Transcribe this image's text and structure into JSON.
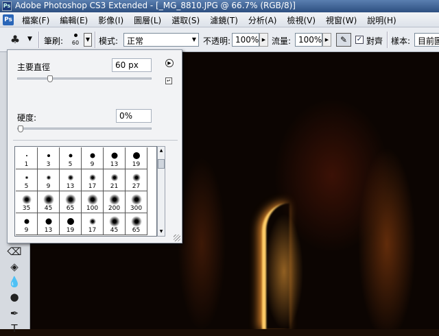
{
  "window": {
    "title": "Adobe Photoshop CS3 Extended - [_MG_8810.JPG @ 66.7% (RGB/8)]",
    "app_logo": "Ps"
  },
  "menubar": {
    "logo": "Ps",
    "items": [
      "檔案(F)",
      "編輯(E)",
      "影像(I)",
      "圖層(L)",
      "選取(S)",
      "濾鏡(T)",
      "分析(A)",
      "檢視(V)",
      "視窗(W)",
      "說明(H)"
    ]
  },
  "options": {
    "tool_icon": "clone-stamp-icon",
    "brush_label": "筆刷:",
    "brush_size": "60",
    "mode_label": "模式:",
    "mode_value": "正常",
    "opacity_label": "不透明:",
    "opacity_value": "100%",
    "flow_label": "流量:",
    "flow_value": "100%",
    "aligned_label": "對齊",
    "aligned_checked": true,
    "sample_label": "樣本:",
    "sample_value": "目前圖"
  },
  "brush_panel": {
    "diameter_label": "主要直徑",
    "diameter_value": "60 px",
    "diameter_fraction": 0.23,
    "hardness_label": "硬度:",
    "hardness_value": "0%",
    "hardness_fraction": 0.0,
    "presets": [
      {
        "size": "1",
        "style": "hard"
      },
      {
        "size": "3",
        "style": "hard"
      },
      {
        "size": "5",
        "style": "hard"
      },
      {
        "size": "9",
        "style": "hard"
      },
      {
        "size": "13",
        "style": "hard"
      },
      {
        "size": "19",
        "style": "hard"
      },
      {
        "size": "5",
        "style": "soft"
      },
      {
        "size": "9",
        "style": "soft"
      },
      {
        "size": "13",
        "style": "soft"
      },
      {
        "size": "17",
        "style": "soft"
      },
      {
        "size": "21",
        "style": "soft"
      },
      {
        "size": "27",
        "style": "soft"
      },
      {
        "size": "35",
        "style": "soft"
      },
      {
        "size": "45",
        "style": "soft"
      },
      {
        "size": "65",
        "style": "soft"
      },
      {
        "size": "100",
        "style": "soft"
      },
      {
        "size": "200",
        "style": "soft"
      },
      {
        "size": "300",
        "style": "soft"
      },
      {
        "size": "9",
        "style": "hard"
      },
      {
        "size": "13",
        "style": "hard"
      },
      {
        "size": "19",
        "style": "hard"
      },
      {
        "size": "17",
        "style": "soft"
      },
      {
        "size": "45",
        "style": "soft"
      },
      {
        "size": "65",
        "style": "soft"
      }
    ]
  },
  "toolbox": {
    "tools": [
      "eraser-icon",
      "paint-bucket-icon",
      "blur-icon",
      "dodge-icon",
      "pen-icon",
      "type-icon"
    ]
  }
}
